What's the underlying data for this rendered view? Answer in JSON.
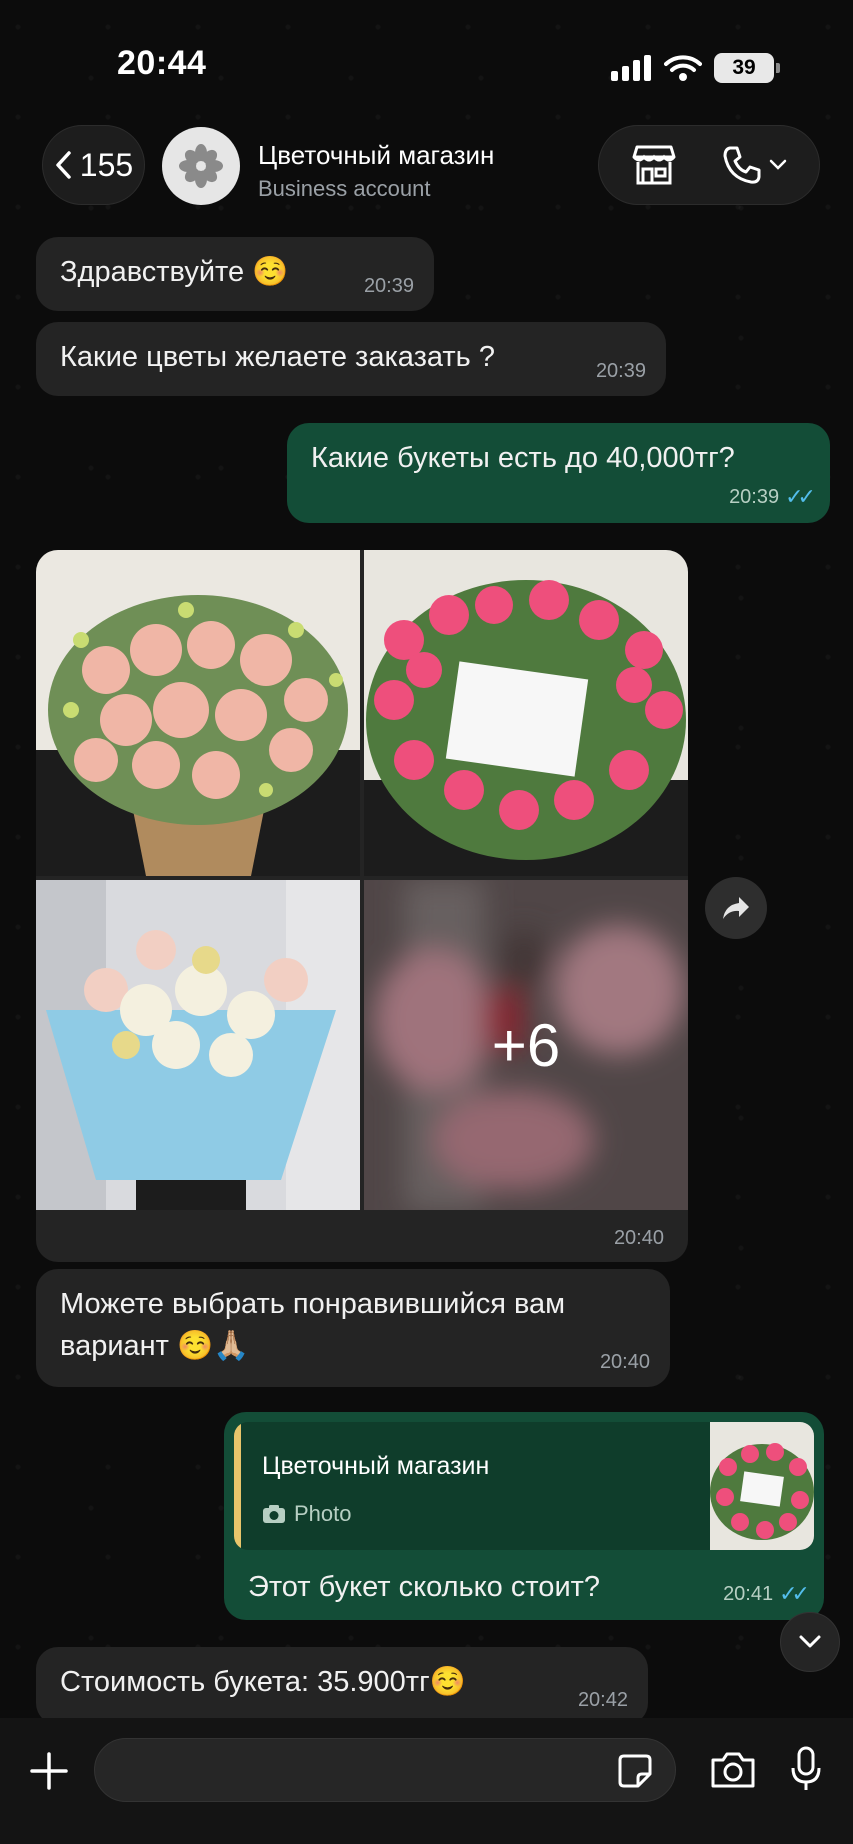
{
  "status_bar": {
    "time": "20:44",
    "battery": "39"
  },
  "header": {
    "back_count": "155",
    "contact_name": "Цветочный магазин",
    "contact_subtitle": "Business account"
  },
  "messages": [
    {
      "direction": "in",
      "text": "Здравствуйте ☺️",
      "time": "20:39"
    },
    {
      "direction": "in",
      "text": "Какие цветы желаете заказать ?",
      "time": "20:39"
    },
    {
      "direction": "out",
      "text": "Какие букеты есть до 40,000тг?",
      "time": "20:39",
      "read": true
    },
    {
      "direction": "in",
      "type": "album",
      "more_count": "+6",
      "time": "20:40"
    },
    {
      "direction": "in",
      "text_line1": "Можете выбрать понравившийся вам",
      "text_line2": "вариант ☺️🙏🏼",
      "time": "20:40"
    },
    {
      "direction": "out",
      "reply_to": {
        "author": "Цветочный магазин",
        "label": "Photo"
      },
      "text": "Этот букет сколько стоит?",
      "time": "20:41",
      "read": true
    },
    {
      "direction": "in",
      "text": "Стоимость букета: 35.900тг☺️",
      "time": "20:42"
    }
  ],
  "composer": {
    "placeholder": ""
  },
  "colors": {
    "incoming_bubble": "#242424",
    "outgoing_bubble": "#134d37",
    "read_tick": "#53bdeb",
    "reply_bar": "#e8c56b"
  }
}
